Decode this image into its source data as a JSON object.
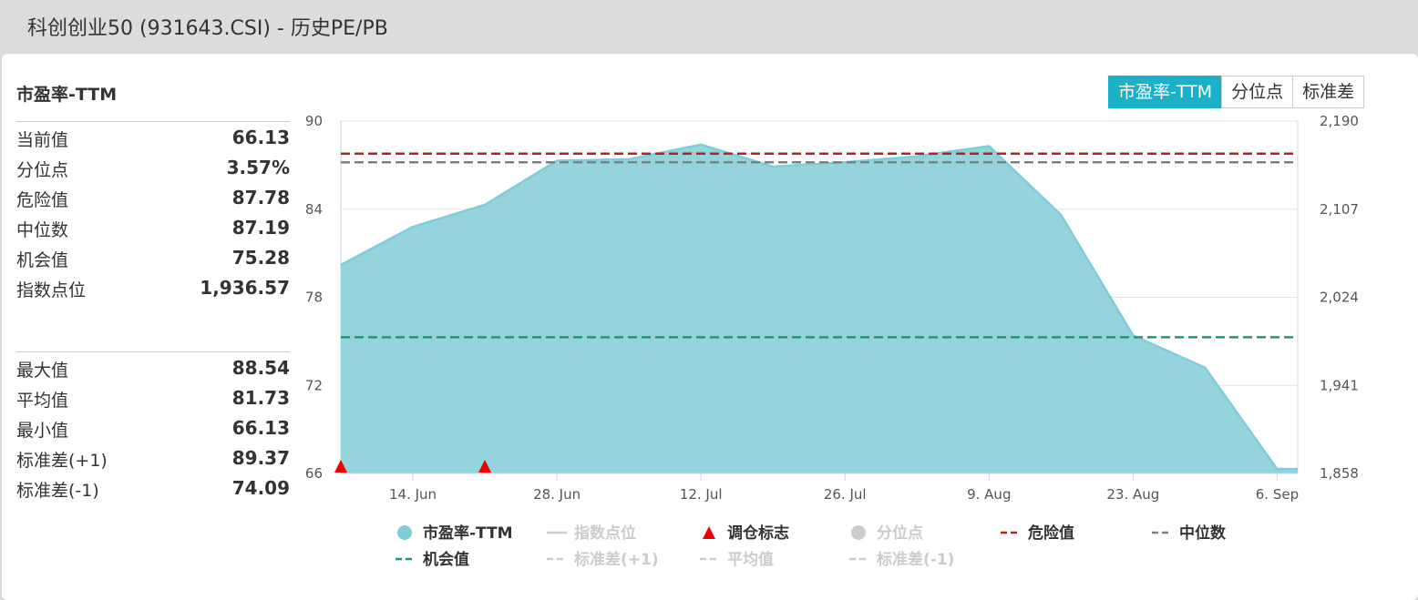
{
  "window": {
    "title": "科创创业50 (931643.CSI) - 历史PE/PB"
  },
  "panel": {
    "title": "市盈率-TTM"
  },
  "tabs": [
    {
      "label": "市盈率-TTM",
      "active": true
    },
    {
      "label": "分位点",
      "active": false
    },
    {
      "label": "标准差",
      "active": false
    }
  ],
  "stats_top": [
    {
      "label": "当前值",
      "value": "66.13"
    },
    {
      "label": "分位点",
      "value": "3.57%"
    },
    {
      "label": "危险值",
      "value": "87.78"
    },
    {
      "label": "中位数",
      "value": "87.19"
    },
    {
      "label": "机会值",
      "value": "75.28"
    },
    {
      "label": "指数点位",
      "value": "1,936.57"
    }
  ],
  "stats_bottom": [
    {
      "label": "最大值",
      "value": "88.54"
    },
    {
      "label": "平均值",
      "value": "81.73"
    },
    {
      "label": "最小值",
      "value": "66.13"
    },
    {
      "label": "标准差(+1)",
      "value": "89.37"
    },
    {
      "label": "标准差(-1)",
      "value": "74.09"
    }
  ],
  "chart_data": {
    "type": "area",
    "x_ticks": [
      "14. Jun",
      "28. Jun",
      "12. Jul",
      "26. Jul",
      "9. Aug",
      "23. Aug",
      "6. Sep"
    ],
    "y_left": {
      "ticks": [
        "90",
        "84",
        "78",
        "72",
        "66"
      ],
      "range": [
        66,
        90
      ]
    },
    "y_right": {
      "ticks": [
        "2,190",
        "2,107",
        "2,024",
        "1,941",
        "1,858"
      ],
      "range": [
        1858,
        2190
      ]
    },
    "series": [
      {
        "name": "市盈率-TTM",
        "color": "#7ecdd8",
        "fill": "#95d3dd",
        "points": [
          [
            "2023-06-07",
            80.2
          ],
          [
            "2023-06-14",
            82.8
          ],
          [
            "2023-06-21",
            84.3
          ],
          [
            "2023-06-28",
            87.3
          ],
          [
            "2023-07-05",
            87.4
          ],
          [
            "2023-07-12",
            88.4
          ],
          [
            "2023-07-19",
            86.9
          ],
          [
            "2023-07-26",
            87.2
          ],
          [
            "2023-08-02",
            87.6
          ],
          [
            "2023-08-09",
            88.3
          ],
          [
            "2023-08-16",
            83.6
          ],
          [
            "2023-08-23",
            75.4
          ],
          [
            "2023-08-30",
            73.2
          ],
          [
            "2023-09-06",
            66.3
          ],
          [
            "2023-09-08",
            66.3
          ]
        ]
      }
    ],
    "reference_lines": [
      {
        "name": "危险值",
        "value": 87.78,
        "color": "#b22222"
      },
      {
        "name": "中位数",
        "value": 87.19,
        "color": "#808080"
      },
      {
        "name": "机会值",
        "value": 75.28,
        "color": "#1a9b6b"
      }
    ],
    "markers": [
      {
        "name": "调仓标志",
        "x": "2023-06-07",
        "color": "#ee0000"
      },
      {
        "name": "调仓标志",
        "x": "2023-06-21",
        "color": "#ee0000"
      }
    ],
    "legend": [
      {
        "label": "市盈率-TTM",
        "symbol": "circle",
        "color": "#7ecdd8",
        "enabled": true
      },
      {
        "label": "指数点位",
        "symbol": "line",
        "color": "#cccccc",
        "enabled": false
      },
      {
        "label": "调仓标志",
        "symbol": "triangle",
        "color": "#ee0000",
        "enabled": true
      },
      {
        "label": "分位点",
        "symbol": "circle",
        "color": "#cccccc",
        "enabled": false
      },
      {
        "label": "危险值",
        "symbol": "dash",
        "color": "#b22222",
        "enabled": true
      },
      {
        "label": "中位数",
        "symbol": "dash",
        "color": "#808080",
        "enabled": true
      },
      {
        "label": "机会值",
        "symbol": "dash",
        "color": "#1a9b6b",
        "enabled": true
      },
      {
        "label": "标准差(+1)",
        "symbol": "dash",
        "color": "#cccccc",
        "enabled": false
      },
      {
        "label": "平均值",
        "symbol": "dash",
        "color": "#cccccc",
        "enabled": false
      },
      {
        "label": "标准差(-1)",
        "symbol": "dash",
        "color": "#cccccc",
        "enabled": false
      }
    ],
    "legend_position": "bottom",
    "grid": true
  }
}
